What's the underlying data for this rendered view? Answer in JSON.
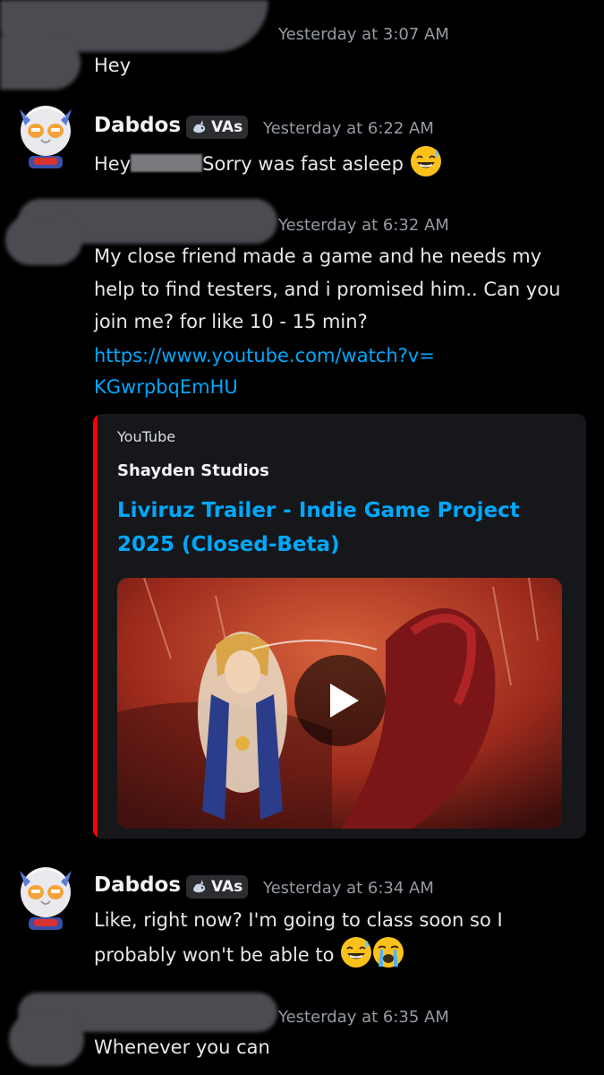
{
  "messages": [
    {
      "timestamp": "Yesterday at 3:07 AM",
      "text": "Hey"
    },
    {
      "author": "Dabdos",
      "tag": "VAs",
      "timestamp": "Yesterday at 6:22 AM",
      "text_before": "Hey",
      "text_after": "Sorry was fast asleep",
      "emoji": "sweat-smile-emoji"
    },
    {
      "timestamp": "Yesterday at 6:32 AM",
      "lines": [
        "My close friend made a game and he needs my",
        "help to find testers, and i promised him.. Can you",
        "join me? for like 10 - 15 min?"
      ],
      "link_lines": [
        "https://www.youtube.com/watch?v=",
        "KGwrpbqEmHU"
      ]
    },
    {
      "author": "Dabdos",
      "tag": "VAs",
      "timestamp": "Yesterday at 6:34 AM",
      "lines": [
        "Like, right now? I'm going to class soon so I",
        "probably won't be able to"
      ],
      "emojis": [
        "sweat-smile-emoji",
        "loudly-crying-emoji"
      ]
    },
    {
      "timestamp": "Yesterday at 6:35 AM",
      "text": "Whenever you can"
    }
  ],
  "embed": {
    "provider": "YouTube",
    "author": "Shayden Studios",
    "title_lines": [
      "Liviruz Trailer - Indie Game Project",
      "2025 (Closed-Beta)"
    ],
    "accent_color": "#ff0000",
    "play_icon": "play-icon"
  },
  "colors": {
    "background": "#000000",
    "link": "#00a8fc",
    "timestamp": "#949ba4"
  }
}
